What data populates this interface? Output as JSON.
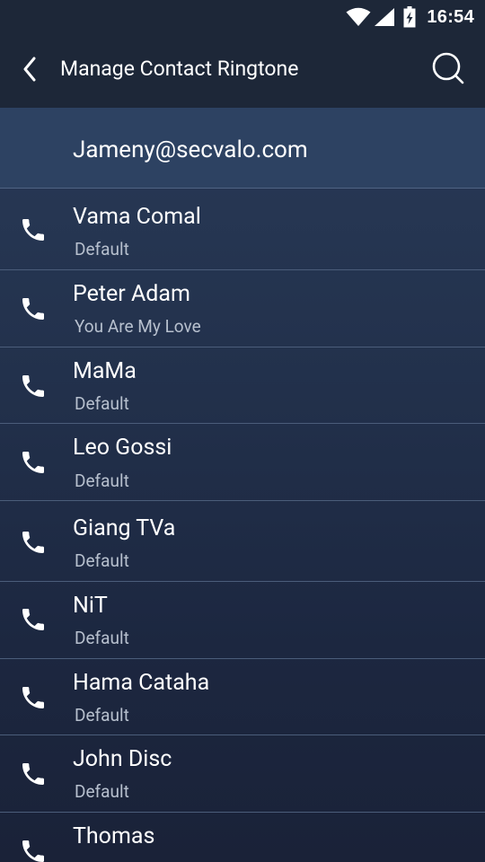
{
  "status_bar": {
    "time": "16:54",
    "icons": [
      "wifi-icon",
      "cell-signal-icon",
      "battery-charging-icon"
    ]
  },
  "app_bar": {
    "title": "Manage Contact Ringtone",
    "back_icon": "chevron-left-icon",
    "search_icon": "search-icon"
  },
  "account": {
    "email": "Jameny@secvalo.com"
  },
  "contacts": [
    {
      "name": "Vama Comal",
      "ringtone": "Default"
    },
    {
      "name": "Peter Adam",
      "ringtone": "You Are My Love"
    },
    {
      "name": "MaMa",
      "ringtone": "Default"
    },
    {
      "name": "Leo Gossi",
      "ringtone": "Default"
    },
    {
      "name": "Giang TVa",
      "ringtone": "Default"
    },
    {
      "name": "NiT",
      "ringtone": "Default"
    },
    {
      "name": "Hama Cataha",
      "ringtone": "Default"
    },
    {
      "name": "John Disc",
      "ringtone": "Default"
    },
    {
      "name": "Thomas",
      "ringtone": ""
    }
  ],
  "colors": {
    "bar_background": "#1d2738",
    "account_header": "#2d4262",
    "secondary_text": "#b7c0ce"
  }
}
